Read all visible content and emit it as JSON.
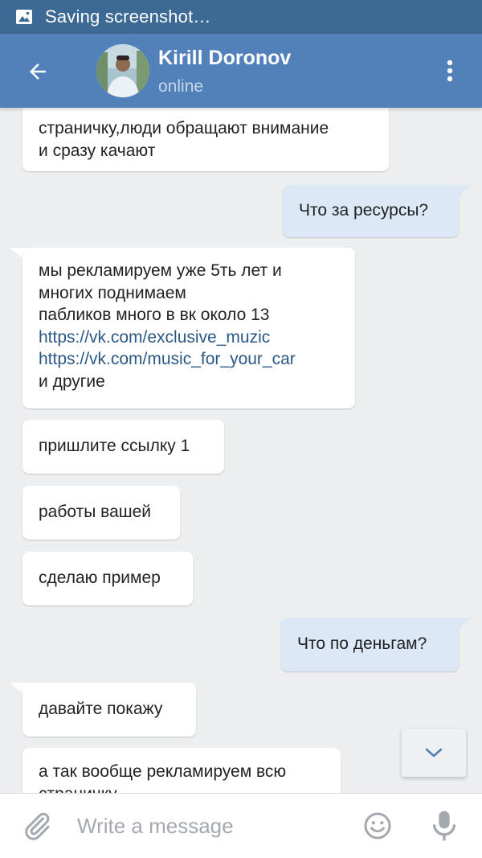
{
  "status_bar": {
    "text": "Saving screenshot…",
    "icon": "image-icon"
  },
  "header": {
    "contact_name": "Kirill Doronov",
    "contact_status": "online",
    "back_icon": "arrow-left-icon",
    "menu_icon": "more-vertical-icon"
  },
  "messages": [
    {
      "direction": "in",
      "lines": [
        "страничку,люди обращают внимание",
        "и сразу качают"
      ]
    },
    {
      "direction": "out",
      "lines": [
        "Что за ресурсы?"
      ]
    },
    {
      "direction": "in",
      "lines": [
        "мы рекламируем уже 5ть лет и",
        "многих поднимаем",
        "паблико­в много в вк около 13"
      ],
      "links": [
        "https://vk.com/exclusive_muzic",
        "https://vk.com/music_for_your_car"
      ],
      "tail_line": "и другие"
    },
    {
      "direction": "in",
      "lines": [
        "пришлите ссылку 1"
      ]
    },
    {
      "direction": "in",
      "lines": [
        "работы вашей"
      ]
    },
    {
      "direction": "in",
      "lines": [
        "сделаю пример"
      ]
    },
    {
      "direction": "out",
      "lines": [
        "Что по деньгам?"
      ]
    },
    {
      "direction": "in",
      "lines": [
        "давайте покажу"
      ]
    },
    {
      "direction": "in",
      "lines": [
        "а так вообще рекламируем всю",
        "страничку"
      ]
    }
  ],
  "scroll_down_icon": "chevron-down-icon",
  "composer": {
    "placeholder": "Write a message",
    "attach_icon": "paperclip-icon",
    "emoji_icon": "smile-icon",
    "mic_icon": "microphone-icon"
  },
  "colors": {
    "status_bar": "#3d6a95",
    "header": "#5181b8",
    "background": "#edeef0",
    "incoming_bubble": "#ffffff",
    "outgoing_bubble": "#dce8f6",
    "link": "#2a5885"
  }
}
